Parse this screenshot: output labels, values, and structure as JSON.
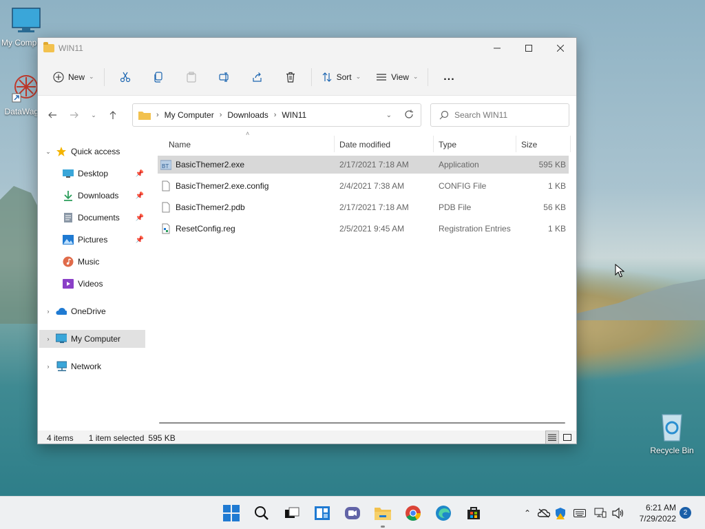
{
  "desktop": {
    "icons": [
      {
        "label": "My Computer"
      },
      {
        "label": "DataWagon"
      },
      {
        "label": "Recycle Bin"
      }
    ]
  },
  "window": {
    "title": "WIN11",
    "commandbar": {
      "new_label": "New",
      "sort_label": "Sort",
      "view_label": "View",
      "more_label": "..."
    },
    "address": {
      "crumbs": [
        "My Computer",
        "Downloads",
        "WIN11"
      ]
    },
    "search": {
      "placeholder": "Search WIN11"
    },
    "nav": {
      "quick_access": "Quick access",
      "items": [
        "Desktop",
        "Downloads",
        "Documents",
        "Pictures",
        "Music",
        "Videos"
      ],
      "onedrive": "OneDrive",
      "my_computer": "My Computer",
      "network": "Network"
    },
    "columns": {
      "name": "Name",
      "date": "Date modified",
      "type": "Type",
      "size": "Size"
    },
    "files": [
      {
        "name": "BasicThemer2.exe",
        "date": "2/17/2021 7:18 AM",
        "type": "Application",
        "size": "595 KB",
        "selected": true
      },
      {
        "name": "BasicThemer2.exe.config",
        "date": "2/4/2021 7:38 AM",
        "type": "CONFIG File",
        "size": "1 KB"
      },
      {
        "name": "BasicThemer2.pdb",
        "date": "2/17/2021 7:18 AM",
        "type": "PDB File",
        "size": "56 KB"
      },
      {
        "name": "ResetConfig.reg",
        "date": "2/5/2021 9:45 AM",
        "type": "Registration Entries",
        "size": "1 KB"
      }
    ],
    "status": {
      "count": "4 items",
      "selection": "1 item selected",
      "selection_size": "595 KB"
    }
  },
  "taskbar": {
    "clock_time": "6:21 AM",
    "clock_date": "7/29/2022",
    "notification_count": "2"
  },
  "colors": {
    "accent": "#0067c0",
    "folder": "#f2c14e",
    "selection": "#d8d8d8",
    "window_chrome": "#f3f3f3"
  }
}
